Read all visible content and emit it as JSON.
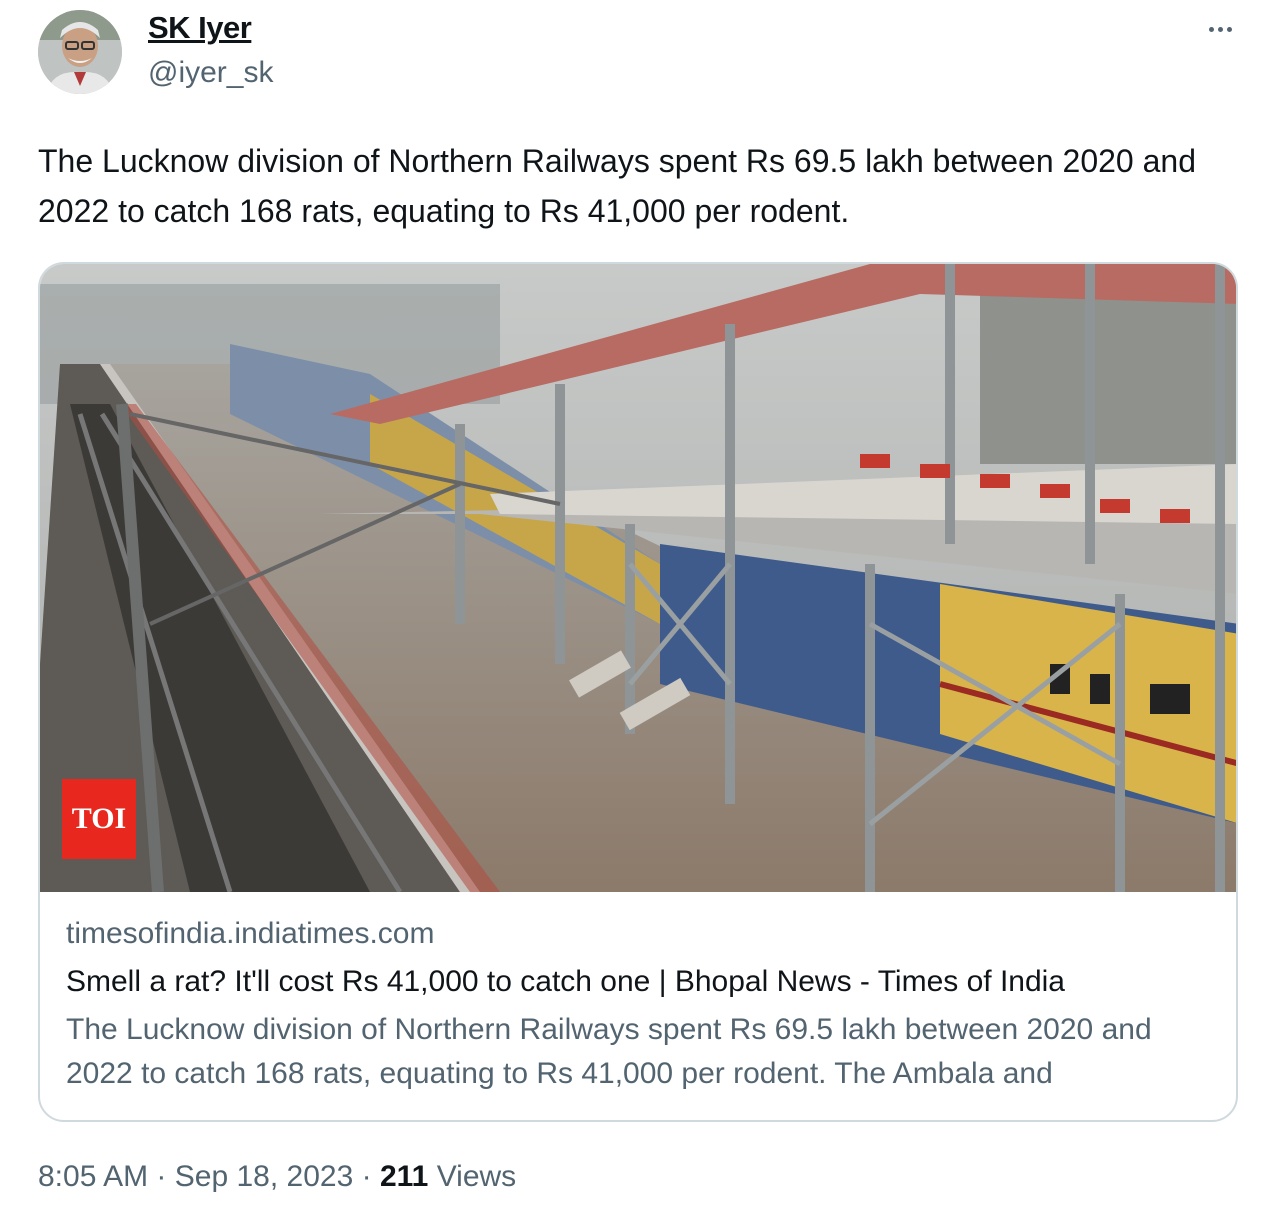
{
  "author": {
    "name": "SK Iyer",
    "handle": "@iyer_sk",
    "avatar_icon": "profile-photo"
  },
  "more_icon": "more-horizontal-icon",
  "tweet": {
    "text": "The Lucknow division of Northern Railways spent Rs 69.5 lakh between 2020 and 2022 to catch 168 rats, equating to Rs 41,000 per rodent."
  },
  "card": {
    "image_subject": "railway-platform-photo",
    "logo_text": "TOI",
    "domain": "timesofindia.indiatimes.com",
    "title": "Smell a rat? It'll cost Rs 41,000 to catch one | Bhopal News - Times of India",
    "description": "The Lucknow division of Northern Railways spent Rs 69.5 lakh between 2020 and 2022 to catch 168 rats, equating to Rs 41,000 per rodent. The Ambala and"
  },
  "meta": {
    "time": "8:05 AM",
    "separator": "·",
    "date": "Sep 18, 2023",
    "views_count": "211",
    "views_label": "Views"
  },
  "colors": {
    "text_primary": "#0f1419",
    "text_secondary": "#536471",
    "border": "#cfd9de",
    "toi_red": "#e8281f"
  }
}
